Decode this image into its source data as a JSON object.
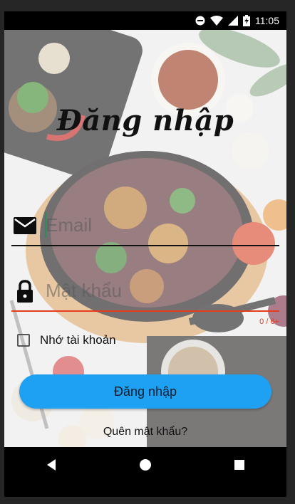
{
  "status_bar": {
    "time": "11:05",
    "icons": [
      "do-not-disturb-icon",
      "wifi-icon",
      "signal-icon",
      "battery-charging-icon"
    ]
  },
  "login": {
    "title": "Đăng nhập",
    "email": {
      "placeholder": "Email",
      "value": "",
      "icon": "mail-icon"
    },
    "password": {
      "placeholder": "Mật khẩu",
      "value": "",
      "icon": "lock-icon",
      "counter": "0 / 6+"
    },
    "remember_label": "Nhớ tài khoản",
    "remember_checked": false,
    "login_button": "Đăng nhập",
    "forgot_link": "Quên mật khẩu?"
  },
  "nav_bar": {
    "buttons": [
      "back-icon",
      "home-icon",
      "recents-icon"
    ]
  },
  "colors": {
    "accent": "#1ea1f2",
    "error": "#e53b1f",
    "caret": "#2e8b57"
  }
}
